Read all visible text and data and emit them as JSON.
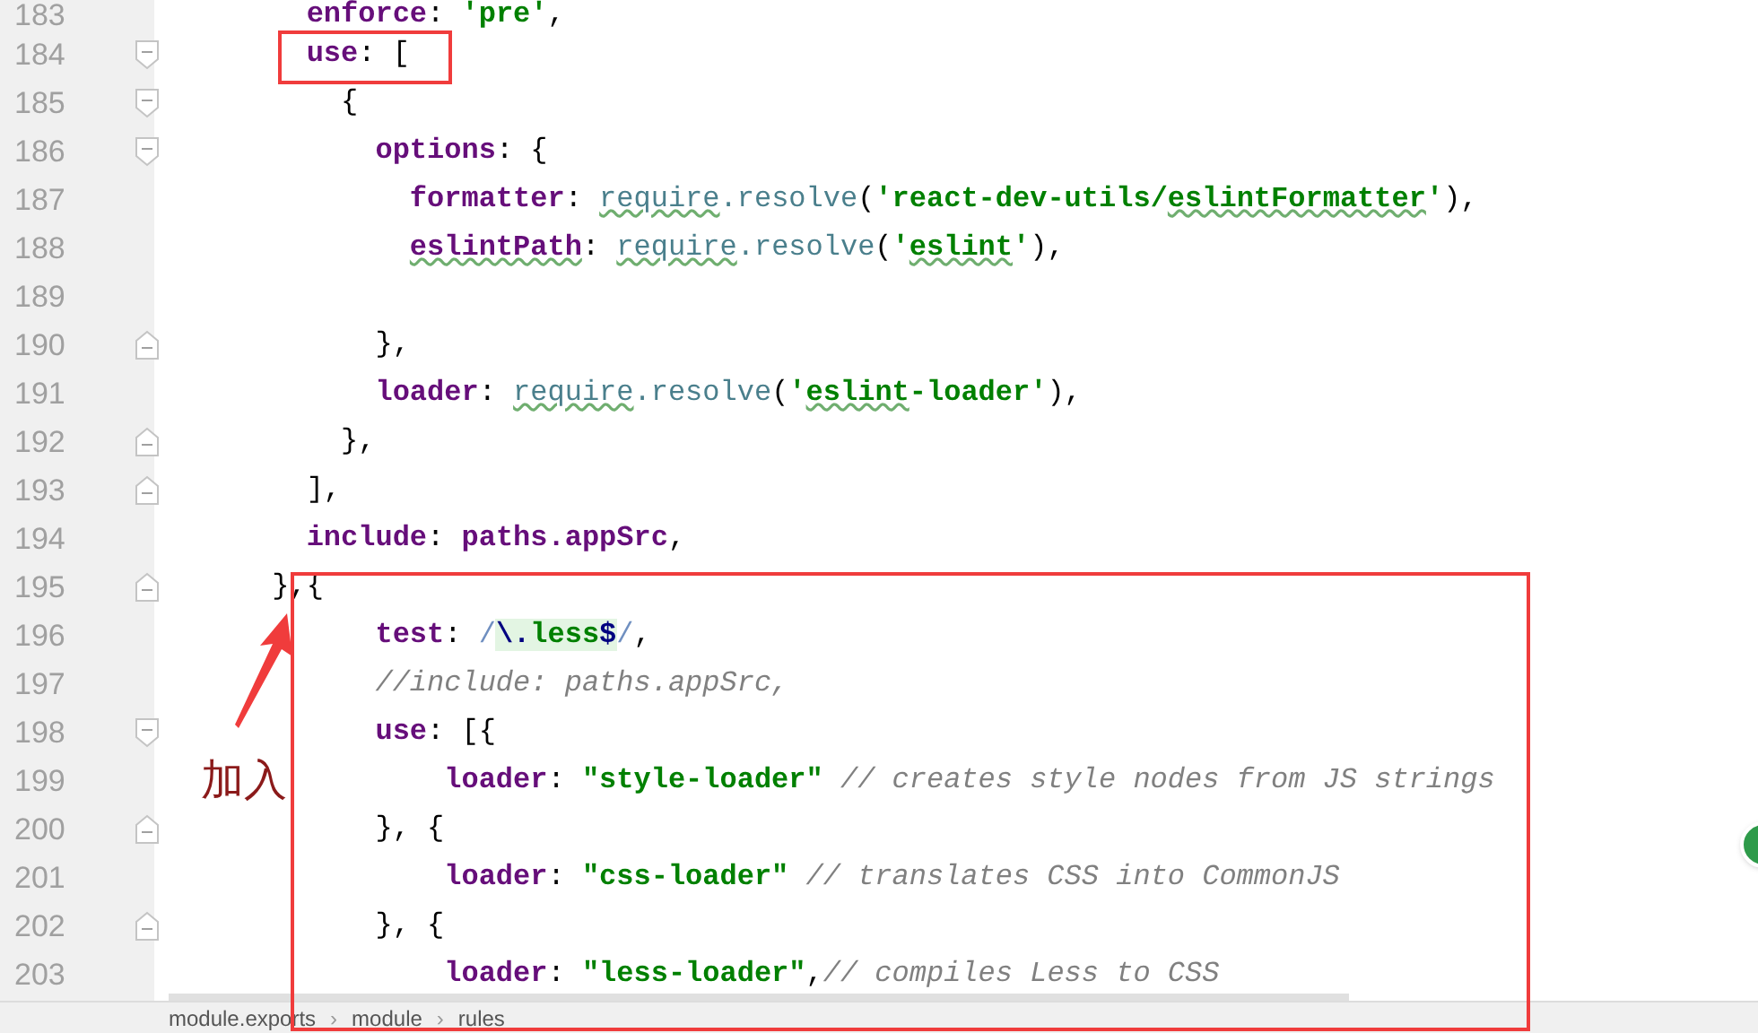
{
  "lines": [
    {
      "number": "183",
      "kind": "plain",
      "tokens": [
        {
          "kind": "key",
          "text": "        enforce"
        },
        {
          "kind": "punct",
          "text": ": "
        },
        {
          "kind": "string",
          "text": "'pre'"
        },
        {
          "kind": "punct",
          "text": ","
        }
      ]
    },
    {
      "number": "184",
      "kind": "fold-start",
      "tokens": [
        {
          "kind": "key",
          "text": "        use"
        },
        {
          "kind": "punct",
          "text": ": ["
        }
      ]
    },
    {
      "number": "185",
      "kind": "fold-start",
      "tokens": [
        {
          "kind": "punct",
          "text": "          {"
        }
      ]
    },
    {
      "number": "186",
      "kind": "fold-start",
      "tokens": [
        {
          "kind": "key",
          "text": "            options"
        },
        {
          "kind": "punct",
          "text": ": {"
        }
      ]
    },
    {
      "number": "187",
      "kind": "plain",
      "tokens": [
        {
          "kind": "key",
          "text": "              formatter",
          "squiggle": false
        },
        {
          "kind": "punct",
          "text": ": ",
          "squiggle": false
        },
        {
          "kind": "fn",
          "text": "require",
          "squiggle": true
        },
        {
          "kind": "fn",
          "text": ".resolve",
          "squiggle": false
        },
        {
          "kind": "punct",
          "text": "(",
          "squiggle": false
        },
        {
          "kind": "string",
          "text": "'react-dev-utils/",
          "squiggle": false
        },
        {
          "kind": "string",
          "text": "eslintFormatter",
          "squiggle": true
        },
        {
          "kind": "string",
          "text": "'",
          "squiggle": false
        },
        {
          "kind": "punct",
          "text": "),",
          "squiggle": false
        }
      ]
    },
    {
      "number": "188",
      "kind": "plain",
      "tokens": [
        {
          "kind": "key",
          "text": "              eslintPath",
          "squiggle": true
        },
        {
          "kind": "punct",
          "text": ": ",
          "squiggle": false
        },
        {
          "kind": "fn",
          "text": "require",
          "squiggle": true
        },
        {
          "kind": "fn",
          "text": ".resolve",
          "squiggle": false
        },
        {
          "kind": "punct",
          "text": "(",
          "squiggle": false
        },
        {
          "kind": "string",
          "text": "'",
          "squiggle": false
        },
        {
          "kind": "string",
          "text": "eslint",
          "squiggle": true
        },
        {
          "kind": "string",
          "text": "'",
          "squiggle": false
        },
        {
          "kind": "punct",
          "text": "),",
          "squiggle": false
        }
      ]
    },
    {
      "number": "189",
      "kind": "plain"
    },
    {
      "number": "190",
      "kind": "fold-end",
      "tokens": [
        {
          "kind": "punct",
          "text": "            },"
        }
      ]
    },
    {
      "number": "191",
      "kind": "plain",
      "tokens": [
        {
          "kind": "key",
          "text": "            loader",
          "squiggle": false
        },
        {
          "kind": "punct",
          "text": ": ",
          "squiggle": false
        },
        {
          "kind": "fn",
          "text": "require",
          "squiggle": true
        },
        {
          "kind": "fn",
          "text": ".resolve",
          "squiggle": false
        },
        {
          "kind": "punct",
          "text": "(",
          "squiggle": false
        },
        {
          "kind": "string",
          "text": "'",
          "squiggle": false
        },
        {
          "kind": "string",
          "text": "eslint",
          "squiggle": true
        },
        {
          "kind": "string",
          "text": "-loader'",
          "squiggle": false
        },
        {
          "kind": "punct",
          "text": "),",
          "squiggle": false
        }
      ]
    },
    {
      "number": "192",
      "kind": "fold-end",
      "tokens": [
        {
          "kind": "punct",
          "text": "          },"
        }
      ]
    },
    {
      "number": "193",
      "kind": "fold-end",
      "tokens": [
        {
          "kind": "punct",
          "text": "        ],"
        }
      ]
    },
    {
      "number": "194",
      "kind": "plain",
      "tokens": [
        {
          "kind": "key",
          "text": "        include"
        },
        {
          "kind": "punct",
          "text": ": "
        },
        {
          "kind": "key",
          "text": "paths.appSrc"
        },
        {
          "kind": "punct",
          "text": ","
        }
      ]
    },
    {
      "number": "195",
      "kind": "fold-end",
      "tokens": [
        {
          "kind": "punct",
          "text": "      },{"
        }
      ]
    },
    {
      "number": "196",
      "kind": "plain",
      "tokens": [
        {
          "kind": "key",
          "text": "            test"
        },
        {
          "kind": "punct",
          "text": ": "
        },
        {
          "kind": "regex_delim",
          "text": "/"
        },
        {
          "kind": "escape",
          "text": "\\."
        },
        {
          "kind": "regex",
          "text": "less"
        },
        {
          "kind": "escape",
          "text": "$"
        },
        {
          "kind": "regex_delim",
          "text": "/"
        },
        {
          "kind": "punct",
          "text": ","
        }
      ]
    },
    {
      "number": "197",
      "kind": "plain",
      "tokens": [
        {
          "kind": "comment",
          "text": "            //include: paths.appSrc,"
        }
      ]
    },
    {
      "number": "198",
      "kind": "fold-start",
      "tokens": [
        {
          "kind": "key",
          "text": "            use"
        },
        {
          "kind": "punct",
          "text": ": [{"
        }
      ]
    },
    {
      "number": "199",
      "kind": "plain",
      "tokens": [
        {
          "kind": "key",
          "text": "                loader"
        },
        {
          "kind": "punct",
          "text": ": "
        },
        {
          "kind": "string",
          "text": "\"style-loader\""
        },
        {
          "kind": "comment",
          "text": " // creates style nodes from JS strings"
        }
      ]
    },
    {
      "number": "200",
      "kind": "fold-end",
      "tokens": [
        {
          "kind": "punct",
          "text": "            }, {"
        }
      ]
    },
    {
      "number": "201",
      "kind": "plain",
      "tokens": [
        {
          "kind": "key",
          "text": "                loader"
        },
        {
          "kind": "punct",
          "text": ": "
        },
        {
          "kind": "string",
          "text": "\"css-loader\""
        },
        {
          "kind": "comment",
          "text": " // translates CSS into CommonJS"
        }
      ]
    },
    {
      "number": "202",
      "kind": "fold-end",
      "tokens": [
        {
          "kind": "punct",
          "text": "            }, {"
        }
      ]
    },
    {
      "number": "203",
      "kind": "plain",
      "tokens": [
        {
          "kind": "key",
          "text": "                loader"
        },
        {
          "kind": "punct",
          "text": ": "
        },
        {
          "kind": "string",
          "text": "\"less-loader\""
        },
        {
          "kind": "punct",
          "text": ","
        },
        {
          "kind": "comment",
          "text": "// compiles Less to CSS"
        }
      ]
    }
  ],
  "annotation": {
    "label": "加入"
  },
  "status_bar": {
    "separator": "›",
    "breadcrumbs": [
      "module.exports",
      "module",
      "rules"
    ]
  }
}
